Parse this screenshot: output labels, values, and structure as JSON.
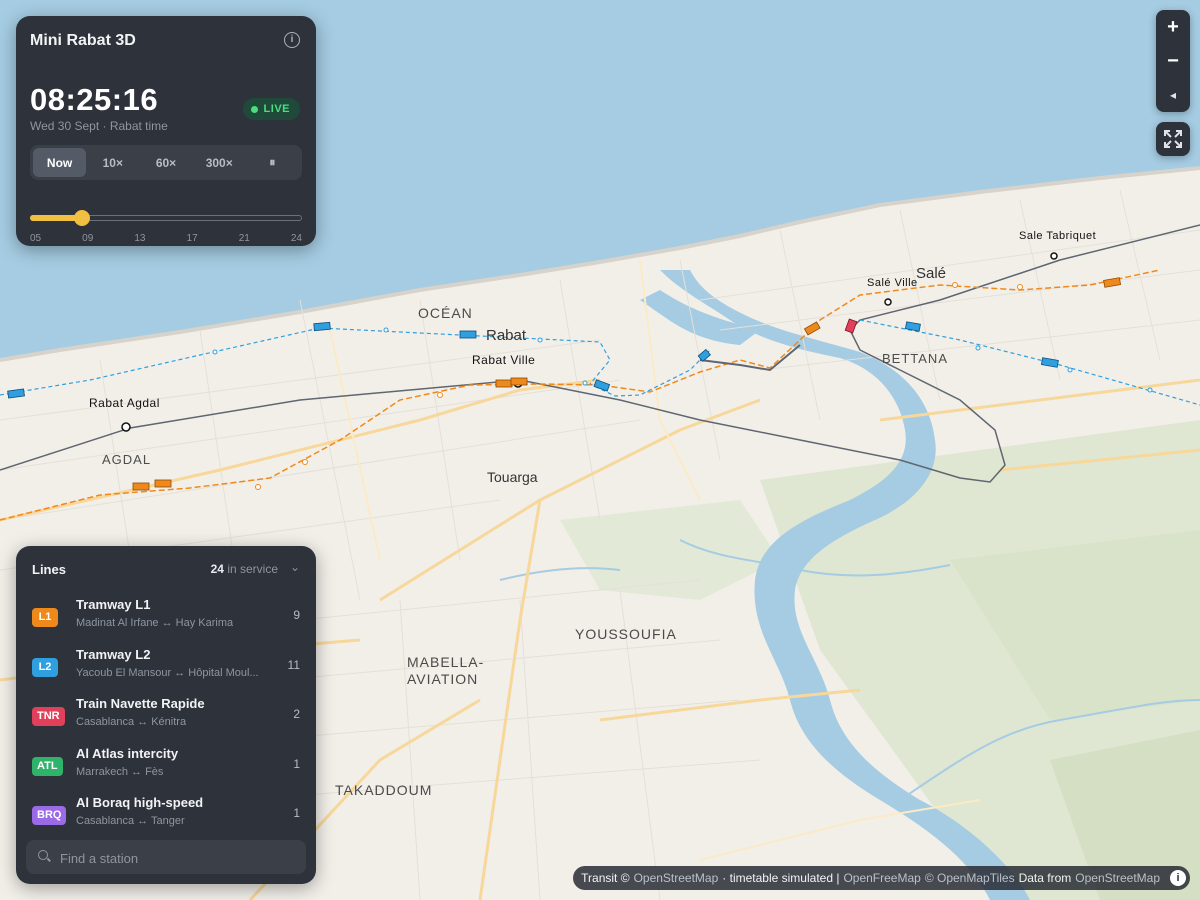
{
  "app": {
    "title": "Mini Rabat 3D"
  },
  "clock": {
    "time": "08:25:16",
    "date": "Wed 30 Sept · Rabat time",
    "live_label": "LIVE",
    "speeds": [
      {
        "label": "Now",
        "active": true
      },
      {
        "label": "10×",
        "active": false
      },
      {
        "label": "60×",
        "active": false
      },
      {
        "label": "300×",
        "active": false
      },
      {
        "label": "⏸",
        "active": false
      }
    ],
    "timeline": {
      "progress": 0.19,
      "ticks": [
        "05",
        "09",
        "13",
        "17",
        "21",
        "24"
      ]
    }
  },
  "lines_panel": {
    "title": "Lines",
    "service_count": "24",
    "service_label": "in service",
    "items": [
      {
        "code": "L1",
        "color": "#f0891c",
        "name": "Tramway L1",
        "route": "Madinat Al Irfane ↔ Hay Karima",
        "count": "9"
      },
      {
        "code": "L2",
        "color": "#2f9fe0",
        "name": "Tramway L2",
        "route": "Yacoub El Mansour ↔ Hôpital Moul...",
        "count": "11"
      },
      {
        "code": "TNR",
        "color": "#e0405a",
        "name": "Train Navette Rapide",
        "route": "Casablanca ↔ Kénitra",
        "count": "2"
      },
      {
        "code": "ATL",
        "color": "#2fb36a",
        "name": "Al Atlas intercity",
        "route": "Marrakech ↔ Fès",
        "count": "1"
      },
      {
        "code": "BRQ",
        "color": "#9b6ae6",
        "name": "Al Boraq high-speed",
        "route": "Casablanca ↔ Tanger",
        "count": "1"
      }
    ],
    "search_placeholder": "Find a station"
  },
  "map": {
    "labels": {
      "ocean": "OCÉAN",
      "rabat": "Rabat",
      "rabat_ville": "Rabat Ville",
      "rabat_agdal": "Rabat Agdal",
      "agdal": "AGDAL",
      "touarga": "Touarga",
      "sale": "Salé",
      "sale_ville": "Salé Ville",
      "sale_tabriquet": "Sale Tabriquet",
      "bettana": "BETTANA",
      "youssoufia": "YOUSSOUFIA",
      "mabella_1": "MABELLA-",
      "mabella_2": "AVIATION",
      "takaddoum": "TAKADDOUM"
    }
  },
  "controls": {
    "zoom_in": "+",
    "zoom_out": "−",
    "compass": "◂"
  },
  "attribution": {
    "transit": "Transit ©",
    "osm": "OpenStreetMap",
    "sim": "· timetable simulated |",
    "ofm": "OpenFreeMap",
    "omt": "© OpenMapTiles",
    "data_from": "Data from",
    "osm2": "OpenStreetMap",
    "info": "i"
  }
}
